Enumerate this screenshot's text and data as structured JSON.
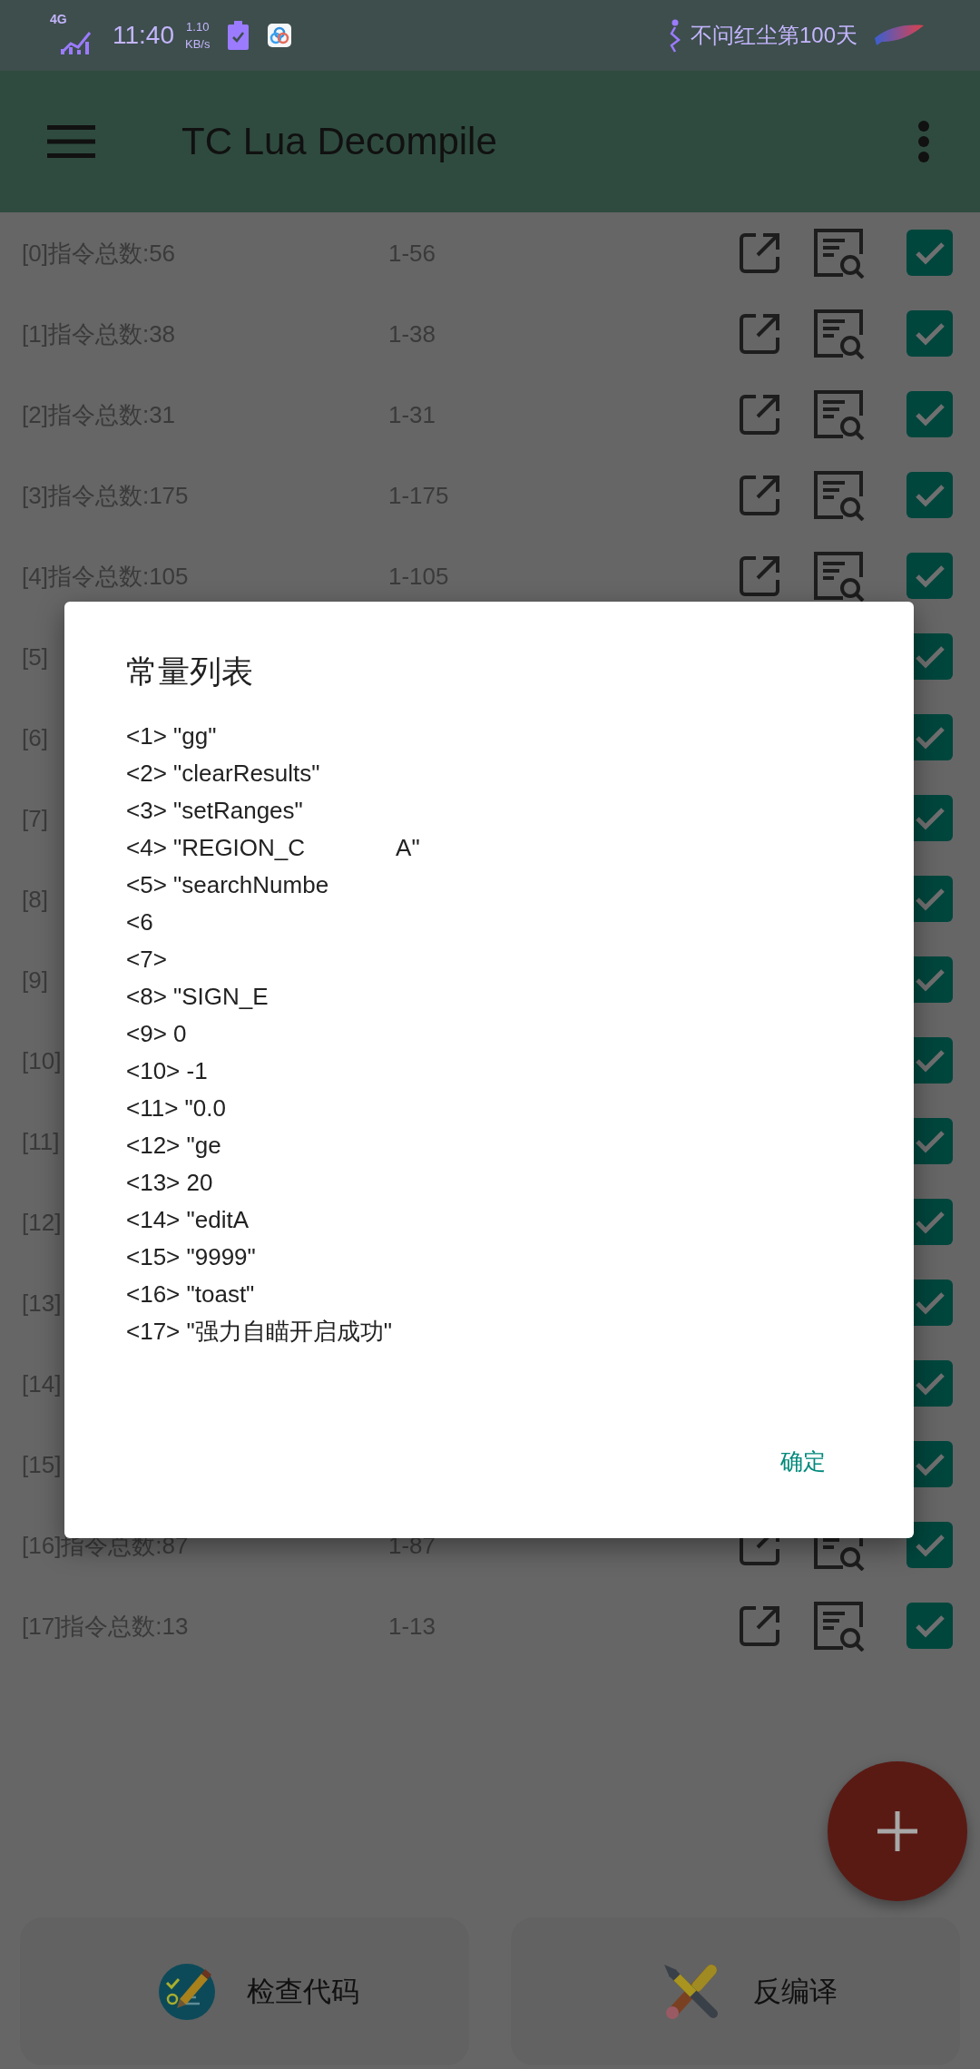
{
  "status_bar": {
    "network_type": "4G",
    "time": "11:40",
    "speed_value": "1.10",
    "speed_unit": "KB/s",
    "status_text": "不问红尘第100天"
  },
  "app_bar": {
    "title": "TC Lua Decompile"
  },
  "rows": [
    {
      "label": "[0]指令总数:56",
      "range": "1-56",
      "checked": true
    },
    {
      "label": "[1]指令总数:38",
      "range": "1-38",
      "checked": true
    },
    {
      "label": "[2]指令总数:31",
      "range": "1-31",
      "checked": true
    },
    {
      "label": "[3]指令总数:175",
      "range": "1-175",
      "checked": true
    },
    {
      "label": "[4]指令总数:105",
      "range": "1-105",
      "checked": true
    },
    {
      "label": "[5]",
      "checked": true
    },
    {
      "label": "[6]",
      "checked": true
    },
    {
      "label": "[7]",
      "checked": true
    },
    {
      "label": "[8]",
      "checked": true
    },
    {
      "label": "[9]",
      "checked": true
    },
    {
      "label": "[10]",
      "checked": true
    },
    {
      "label": "[11]",
      "checked": true
    },
    {
      "label": "[12]",
      "checked": true
    },
    {
      "label": "[13]",
      "checked": true
    },
    {
      "label": "[14]",
      "checked": true
    },
    {
      "label": "[15]",
      "checked": true
    },
    {
      "label": "[16]指令总数:87",
      "range": "1-87",
      "checked": true
    },
    {
      "label": "[17]指令总数:13",
      "range": "1-13",
      "checked": true
    }
  ],
  "dialog": {
    "title": "常量列表",
    "constants": [
      {
        "parts": [
          "<1> \"gg\""
        ]
      },
      {
        "parts": [
          "<2> \"clearResults\""
        ]
      },
      {
        "parts": [
          "<3> \"setRanges\""
        ]
      },
      {
        "parts": [
          "<4> \"REGION_C",
          "A\""
        ]
      },
      {
        "parts": [
          "<5> \"searchNumbe"
        ]
      },
      {
        "parts": [
          "<6"
        ]
      },
      {
        "parts": [
          "<7>"
        ]
      },
      {
        "parts": [
          "<8> \"SIGN_E"
        ]
      },
      {
        "parts": [
          "<9> 0"
        ]
      },
      {
        "parts": [
          "<10> -1"
        ]
      },
      {
        "parts": [
          "<11> \"0.0"
        ]
      },
      {
        "parts": [
          "<12> \"ge"
        ]
      },
      {
        "parts": [
          "<13> 20"
        ]
      },
      {
        "parts": [
          "<14> \"editA"
        ]
      },
      {
        "parts": [
          "<15> \"9999\""
        ]
      },
      {
        "parts": [
          "<16> \"toast\""
        ]
      },
      {
        "parts": [
          "<17> \"强力自瞄开启成功\""
        ]
      }
    ],
    "confirm_button": "确定"
  },
  "bottom_buttons": [
    {
      "kind": "check",
      "label": "检查代码"
    },
    {
      "kind": "decompile",
      "label": "反编译"
    }
  ]
}
